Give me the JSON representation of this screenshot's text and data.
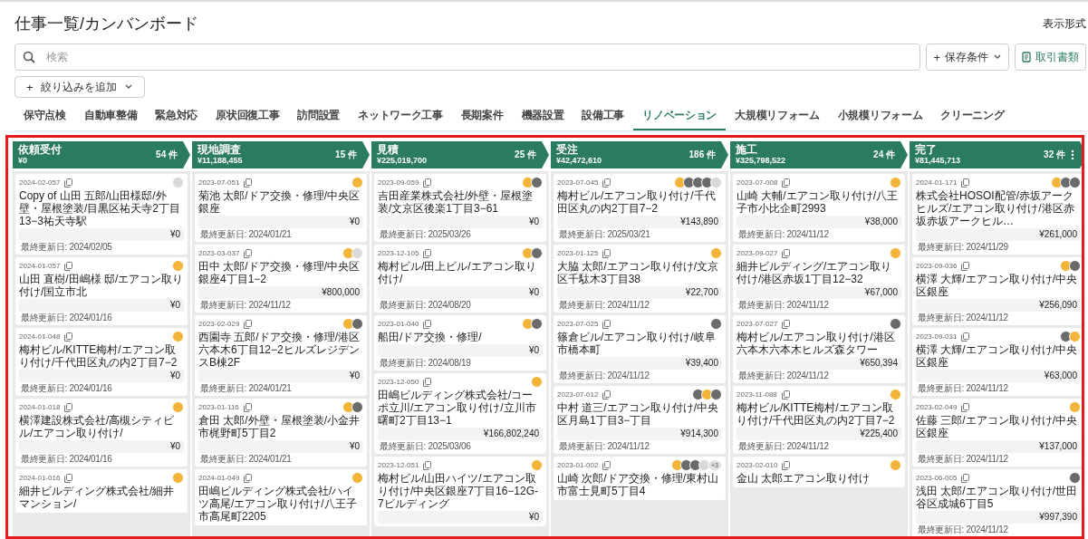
{
  "page_title": "仕事一覧/カンバンボード",
  "view_label": "表示形式",
  "search": {
    "placeholder": "検索"
  },
  "save_button": {
    "icon": "+",
    "label": "保存条件"
  },
  "documents_button": {
    "label": "取引書類"
  },
  "filter_button": {
    "icon": "+",
    "label": "絞り込みを追加"
  },
  "tabs": [
    {
      "label": "保守点検",
      "selected": false
    },
    {
      "label": "自動車整備",
      "selected": false
    },
    {
      "label": "緊急対応",
      "selected": false
    },
    {
      "label": "原状回復工事",
      "selected": false
    },
    {
      "label": "訪問設置",
      "selected": false
    },
    {
      "label": "ネットワーク工事",
      "selected": false
    },
    {
      "label": "長期案件",
      "selected": false
    },
    {
      "label": "機器設置",
      "selected": false
    },
    {
      "label": "設備工事",
      "selected": false
    },
    {
      "label": "リノベーション",
      "selected": true
    },
    {
      "label": "大規模リフォーム",
      "selected": false
    },
    {
      "label": "小規模リフォーム",
      "selected": false
    },
    {
      "label": "クリーニング",
      "selected": false
    }
  ],
  "columns": [
    {
      "name": "依頼受付",
      "total": "¥0",
      "count": "54 件",
      "menu": false,
      "cards": [
        {
          "id": "2024-02-057",
          "title": "Copy of 山田 五郎/山田様邸/外壁・屋根塗装/目黒区祐天寺2丁目13−3祐天寺駅",
          "amount": "¥0",
          "updated": "最終更新日: 2024/02/05",
          "avatars": [
            {
              "kind": "initial"
            }
          ]
        },
        {
          "id": "2024-01-057",
          "title": "山田 直樹/田嶋様 邸/エアコン取り付け/国立市北",
          "amount": "¥0",
          "updated": "最終更新日: 2024/01/16",
          "avatars": [
            {
              "kind": "mascot"
            }
          ]
        },
        {
          "id": "2024-01-048",
          "title": "梅村ビル/KITTE梅村/エアコン取り付け/千代田区丸の内2丁目7−2",
          "amount": "¥0",
          "updated": "最終更新日: 2024/01/16",
          "avatars": [
            {
              "kind": "mascot"
            }
          ]
        },
        {
          "id": "2024-01-018",
          "title": "横澤建設株式会社/高槻シティビル/エアコン取り付け/",
          "amount": "¥0",
          "updated": "最終更新日: 2024/01/16",
          "avatars": [
            {
              "kind": "mascot"
            }
          ]
        },
        {
          "id": "2024-01-016",
          "title": "細井ビルディング株式会社/細井マンション/",
          "avatars": [
            {
              "kind": "mascot"
            }
          ]
        }
      ]
    },
    {
      "name": "現地調査",
      "total": "¥11,188,455",
      "count": "15 件",
      "menu": false,
      "cards": [
        {
          "id": "2023-07-051",
          "title": "菊池 太郎/ドア交換・修理/中央区銀座",
          "amount": "¥0",
          "updated": "最終更新日: 2024/01/21",
          "avatars": [
            {
              "kind": "mascot"
            }
          ]
        },
        {
          "id": "2023-03-037",
          "title": "田中 太郎/ドア交換・修理/中央区銀座4丁目1−2",
          "amount": "¥800,000",
          "updated": "最終更新日: 2024/11/12",
          "avatars": [
            {
              "kind": "mascot"
            },
            {
              "kind": "initial"
            }
          ]
        },
        {
          "id": "2023-02-029",
          "title": "西園寺 五郎/ドア交換・修理/港区六本木6丁目12−2ヒルズレジデンスB棟2F",
          "amount": "¥0",
          "updated": "最終更新日: 2024/01/21",
          "avatars": [
            {
              "kind": "mascot"
            },
            {
              "kind": "photo"
            }
          ]
        },
        {
          "id": "2023-01-116",
          "title": "倉田 太郎/外壁・屋根塗装/小金井市梶野町5丁目2",
          "amount": "¥0",
          "updated": "最終更新日: 2024/01/21",
          "avatars": [
            {
              "kind": "mascot"
            },
            {
              "kind": "photo"
            }
          ]
        },
        {
          "id": "2024-01-049",
          "title": "田嶋ビルディング株式会社/ハイツ高尾/エアコン取り付け/八王子市高尾町2205",
          "avatars": [
            {
              "kind": "mascot"
            }
          ]
        }
      ]
    },
    {
      "name": "見積",
      "total": "¥225,019,700",
      "count": "25 件",
      "menu": false,
      "cards": [
        {
          "id": "2023-09-059",
          "title": "吉田産業株式会社/外壁・屋根塗装/文京区後楽1丁目3−61",
          "amount": "¥0",
          "updated": "最終更新日: 2025/03/26",
          "avatars": [
            {
              "kind": "mascot"
            },
            {
              "kind": "photo"
            }
          ]
        },
        {
          "id": "2023-12-105",
          "title": "梅村ビル/田上ビル/エアコン取り付け/",
          "amount": "¥0",
          "updated": "最終更新日: 2024/08/20",
          "avatars": [
            {
              "kind": "mascot"
            },
            {
              "kind": "photo"
            }
          ]
        },
        {
          "id": "2023-01-040",
          "title": "船田/ドア交換・修理/",
          "amount": "¥0",
          "updated": "最終更新日: 2024/08/19",
          "avatars": [
            {
              "kind": "mascot"
            },
            {
              "kind": "photo"
            }
          ]
        },
        {
          "id": "2023-12-050",
          "title": "田嶋ビルディング株式会社/コーポ立川/エアコン取り付け/立川市曙町2丁目13−1",
          "amount": "¥166,802,240",
          "updated": "最終更新日: 2025/03/06",
          "avatars": [
            {
              "kind": "mascot"
            }
          ]
        },
        {
          "id": "2023-12-051",
          "title": "梅村ビル/山田ハイツ/エアコン取り付け/中央区銀座7丁目16−12G-7ビルディング",
          "amount": "¥0",
          "avatars": [
            {
              "kind": "mascot"
            }
          ]
        }
      ]
    },
    {
      "name": "受注",
      "total": "¥42,472,610",
      "count": "186 件",
      "menu": false,
      "cards": [
        {
          "id": "2023-07-045",
          "title": "梅村ビル/エアコン取り付け/千代田区丸の内2丁目7−2",
          "amount": "¥143,890",
          "updated": "最終更新日: 2025/03/21",
          "avatars": [
            {
              "kind": "mascot"
            },
            {
              "kind": "photo"
            },
            {
              "kind": "photo"
            },
            {
              "kind": "photo"
            },
            {
              "kind": "initial"
            }
          ]
        },
        {
          "id": "2023-01-125",
          "title": "大脇 太郎/エアコン取り付け/文京区千駄木3丁目38",
          "amount": "¥22,700",
          "updated": "最終更新日: 2024/11/12",
          "avatars": [
            {
              "kind": "mascot"
            }
          ]
        },
        {
          "id": "2023-07-025",
          "title": "篠倉ビル/エアコン取り付け/岐阜市橋本町",
          "amount": "¥39,400",
          "updated": "最終更新日: 2024/11/12",
          "avatars": [
            {
              "kind": "photo"
            }
          ]
        },
        {
          "id": "2023-07-012",
          "title": "中村 道三/エアコン取り付け/中央区月島1丁目3−丁目",
          "amount": "¥914,300",
          "updated": "最終更新日: 2024/11/12",
          "avatars": [
            {
              "kind": "photo"
            },
            {
              "kind": "mascot"
            },
            {
              "kind": "photo"
            }
          ]
        },
        {
          "id": "2023-01-002",
          "title": "山崎 次郎/ドア交換・修理/東村山市富士見町5丁目4",
          "avatars": [
            {
              "kind": "mascot"
            },
            {
              "kind": "photo"
            },
            {
              "kind": "photo"
            },
            {
              "kind": "initial"
            },
            {
              "kind": "more",
              "text": "+3"
            }
          ]
        }
      ]
    },
    {
      "name": "施工",
      "total": "¥325,798,522",
      "count": "24 件",
      "menu": false,
      "cards": [
        {
          "id": "2023-07-008",
          "title": "山崎 大輔/エアコン取り付け/八王子市小比企町2993",
          "amount": "¥38,000",
          "updated": "最終更新日: 2024/11/12",
          "avatars": [
            {
              "kind": "mascot"
            }
          ]
        },
        {
          "id": "2023-09-027",
          "title": "細井ビルディング/エアコン取り付け/港区赤坂1丁目12−32",
          "amount": "¥67,000",
          "updated": "最終更新日: 2024/11/12",
          "avatars": [
            {
              "kind": "mascot"
            }
          ]
        },
        {
          "id": "2023-07-027",
          "title": "梅村ビル/エアコン取り付け/港区六本木六本木ヒルズ森タワー",
          "amount": "¥650,394",
          "updated": "最終更新日: 2024/11/12",
          "avatars": [
            {
              "kind": "photo"
            }
          ]
        },
        {
          "id": "2023-11-088",
          "title": "梅村ビル/KITTE梅村/エアコン取り付け/千代田区丸の内2丁目7−2",
          "amount": "¥225,400",
          "updated": "最終更新日: 2024/11/12",
          "avatars": [
            {
              "kind": "mascot"
            }
          ]
        },
        {
          "id": "2023-02-010",
          "title": "金山 太郎エアコン取り付け",
          "avatars": [
            {
              "kind": "mascot"
            }
          ]
        }
      ]
    },
    {
      "name": "完了",
      "total": "¥81,445,713",
      "count": "32 件",
      "menu": true,
      "cards": [
        {
          "id": "2024-01-171",
          "title": "株式会社HOSOI配管/赤坂アークヒルズ/エアコン取り付け/港区赤坂赤坂アークヒル…",
          "amount": "¥261,000",
          "updated": "最終更新日: 2024/11/29",
          "avatars": [
            {
              "kind": "mascot"
            },
            {
              "kind": "photo"
            },
            {
              "kind": "photo"
            }
          ]
        },
        {
          "id": "2023-09-036",
          "title": "横澤 大輝/エアコン取り付け/中央区銀座",
          "amount": "¥256,090",
          "updated": "最終更新日: 2024/11/12",
          "avatars": [
            {
              "kind": "mascot"
            },
            {
              "kind": "photo"
            }
          ]
        },
        {
          "id": "2023-09-031",
          "title": "横澤 大輝/エアコン取り付け/中央区銀座",
          "amount": "¥63,000",
          "updated": "最終更新日: 2024/11/12",
          "avatars": [
            {
              "kind": "photo"
            },
            {
              "kind": "mascot"
            }
          ]
        },
        {
          "id": "2023-02-049",
          "title": "佐藤 三郎/エアコン取り付け/中央区銀座",
          "amount": "¥137,000",
          "updated": "最終更新日: 2024/11/12",
          "avatars": [
            {
              "kind": "mascot"
            }
          ]
        },
        {
          "id": "2023-06-005",
          "title": "浅田 太郎/エアコン取り付け/世田谷区成城6丁目5",
          "amount": "¥997,390",
          "updated": "最終更新日: 2024/11/12",
          "avatars": [
            {
              "kind": "photo"
            }
          ]
        }
      ]
    }
  ]
}
